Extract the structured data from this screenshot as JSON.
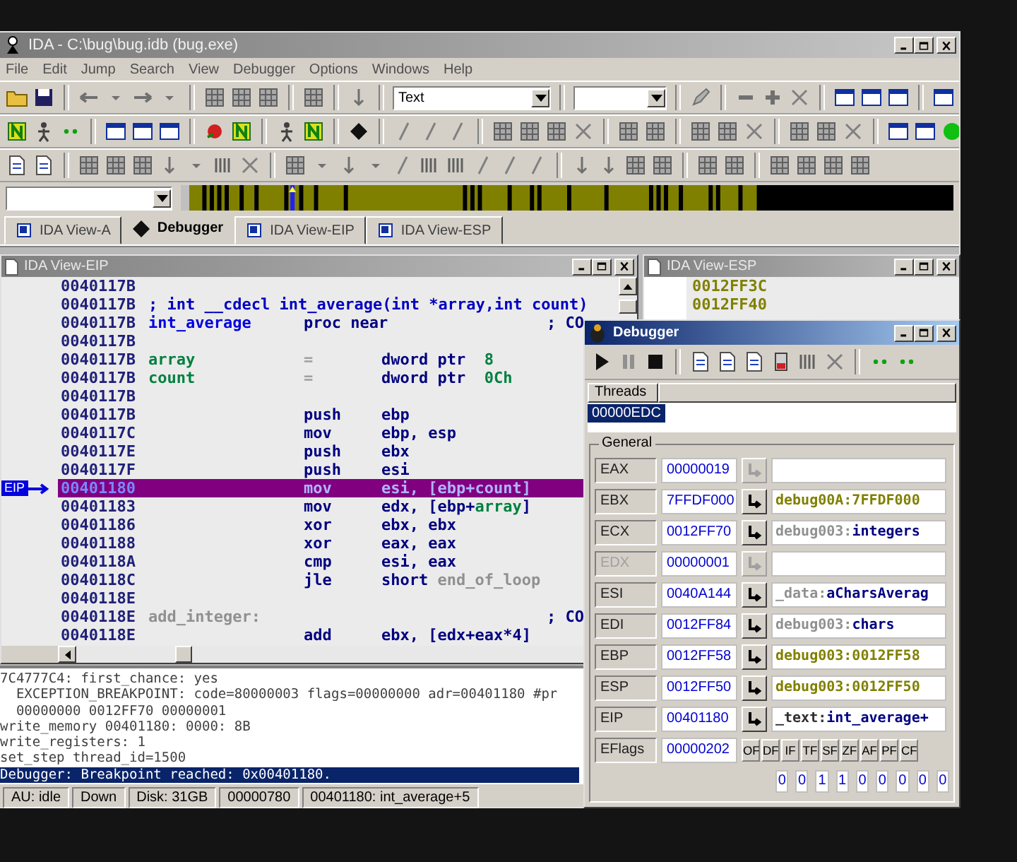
{
  "window": {
    "title": "IDA - C:\\bug\\bug.idb (bug.exe)"
  },
  "menu": [
    "File",
    "Edit",
    "Jump",
    "Search",
    "View",
    "Debugger",
    "Options",
    "Windows",
    "Help"
  ],
  "toolbar": {
    "text_combo": "Text"
  },
  "tabs": [
    {
      "label": "IDA View-A",
      "kind": "view",
      "selected": false
    },
    {
      "label": "Debugger",
      "kind": "debugger",
      "selected": true
    },
    {
      "label": "IDA View-EIP",
      "kind": "view",
      "selected": false
    },
    {
      "label": "IDA View-ESP",
      "kind": "view",
      "selected": false
    }
  ],
  "eip_view": {
    "title": "IDA View-EIP",
    "eip_marker": "EIP",
    "lines": [
      {
        "address": "0040117B",
        "kind": "blank",
        "selected": false
      },
      {
        "address": "0040117B",
        "kind": "comment",
        "text": "; int __cdecl int_average(int *array,int count)",
        "selected": false
      },
      {
        "address": "0040117B",
        "kind": "proc",
        "label": "int_average",
        "mnemonic": "proc near",
        "comment": "; CO",
        "selected": false
      },
      {
        "address": "0040117B",
        "kind": "blank",
        "selected": false
      },
      {
        "address": "0040117B",
        "kind": "stack_var",
        "label": "array",
        "mnemonic": "=",
        "operand": [
          {
            "text": "dword ptr  ",
            "kind": "plain"
          },
          {
            "text": "8",
            "kind": "number"
          }
        ],
        "selected": false
      },
      {
        "address": "0040117B",
        "kind": "stack_var",
        "label": "count",
        "mnemonic": "=",
        "operand": [
          {
            "text": "dword ptr  ",
            "kind": "plain"
          },
          {
            "text": "0Ch",
            "kind": "number"
          }
        ],
        "selected": false
      },
      {
        "address": "0040117B",
        "kind": "blank",
        "selected": false
      },
      {
        "address": "0040117B",
        "kind": "code",
        "mnemonic": "push",
        "operand": [
          {
            "text": "ebp",
            "kind": "plain"
          }
        ],
        "selected": false
      },
      {
        "address": "0040117C",
        "kind": "code",
        "mnemonic": "mov",
        "operand": [
          {
            "text": "ebp, esp",
            "kind": "plain"
          }
        ],
        "selected": false
      },
      {
        "address": "0040117E",
        "kind": "code",
        "mnemonic": "push",
        "operand": [
          {
            "text": "ebx",
            "kind": "plain"
          }
        ],
        "selected": false
      },
      {
        "address": "0040117F",
        "kind": "code",
        "mnemonic": "push",
        "operand": [
          {
            "text": "esi",
            "kind": "plain"
          }
        ],
        "selected": false
      },
      {
        "address": "00401180",
        "kind": "code",
        "mnemonic": "mov",
        "operand": [
          {
            "text": "esi, [ebp+",
            "kind": "plain"
          },
          {
            "text": "count",
            "kind": "var"
          },
          {
            "text": "]",
            "kind": "plain"
          }
        ],
        "selected": true
      },
      {
        "address": "00401183",
        "kind": "code",
        "mnemonic": "mov",
        "operand": [
          {
            "text": "edx, [ebp+",
            "kind": "plain"
          },
          {
            "text": "array",
            "kind": "var"
          },
          {
            "text": "]",
            "kind": "plain"
          }
        ],
        "selected": false
      },
      {
        "address": "00401186",
        "kind": "code",
        "mnemonic": "xor",
        "operand": [
          {
            "text": "ebx, ebx",
            "kind": "plain"
          }
        ],
        "selected": false
      },
      {
        "address": "00401188",
        "kind": "code",
        "mnemonic": "xor",
        "operand": [
          {
            "text": "eax, eax",
            "kind": "plain"
          }
        ],
        "selected": false
      },
      {
        "address": "0040118A",
        "kind": "code",
        "mnemonic": "cmp",
        "operand": [
          {
            "text": "esi, eax",
            "kind": "plain"
          }
        ],
        "selected": false
      },
      {
        "address": "0040118C",
        "kind": "code",
        "mnemonic": "jle",
        "operand": [
          {
            "text": "short ",
            "kind": "plain"
          },
          {
            "text": "end_of_loop",
            "kind": "loc"
          }
        ],
        "selected": false
      },
      {
        "address": "0040118E",
        "kind": "blank",
        "selected": false
      },
      {
        "address": "0040118E",
        "kind": "location",
        "label": "add_integer:",
        "comment": "; CO",
        "selected": false
      },
      {
        "address": "0040118E",
        "kind": "code",
        "mnemonic": "add",
        "operand": [
          {
            "text": "ebx, [edx+eax*4]",
            "kind": "plain"
          }
        ],
        "selected": false
      }
    ]
  },
  "esp_view": {
    "title": "IDA View-ESP",
    "lines": [
      "0012FF3C",
      "0012FF40"
    ]
  },
  "debugger": {
    "title": "Debugger",
    "threads_header": "Threads",
    "threads": [
      {
        "id": "00000EDC",
        "selected": true
      }
    ],
    "group": "General",
    "registers": [
      {
        "name": "EAX",
        "value": "00000019",
        "disabled": false
      },
      {
        "name": "EBX",
        "value": "7FFDF000",
        "disabled": false,
        "ref": [
          {
            "text": "debug00A:7FFDF000",
            "kind": "data"
          }
        ]
      },
      {
        "name": "ECX",
        "value": "0012FF70",
        "disabled": false,
        "ref": [
          {
            "text": "debug003:",
            "kind": "seg"
          },
          {
            "text": "integers",
            "kind": "name"
          }
        ]
      },
      {
        "name": "EDX",
        "value": "00000001",
        "disabled": true
      },
      {
        "name": "ESI",
        "value": "0040A144",
        "disabled": false,
        "ref": [
          {
            "text": "_data:",
            "kind": "seg"
          },
          {
            "text": "aCharsAverag",
            "kind": "name"
          }
        ]
      },
      {
        "name": "EDI",
        "value": "0012FF84",
        "disabled": false,
        "ref": [
          {
            "text": "debug003:",
            "kind": "seg"
          },
          {
            "text": "chars",
            "kind": "name"
          }
        ]
      },
      {
        "name": "EBP",
        "value": "0012FF58",
        "disabled": false,
        "ref": [
          {
            "text": "debug003:0012FF58",
            "kind": "data"
          }
        ]
      },
      {
        "name": "ESP",
        "value": "0012FF50",
        "disabled": false,
        "ref": [
          {
            "text": "debug003:0012FF50",
            "kind": "data"
          }
        ]
      },
      {
        "name": "EIP",
        "value": "00401180",
        "disabled": false,
        "ref": [
          {
            "text": "_text:",
            "kind": "code_seg"
          },
          {
            "text": "int_average+",
            "kind": "name"
          }
        ]
      }
    ],
    "eflags": {
      "name": "EFlags",
      "value": "00000202"
    },
    "flags": [
      {
        "name": "OF",
        "value": "0"
      },
      {
        "name": "DF",
        "value": "0"
      },
      {
        "name": "IF",
        "value": "1"
      },
      {
        "name": "TF",
        "value": "1"
      },
      {
        "name": "SF",
        "value": "0"
      },
      {
        "name": "ZF",
        "value": "0"
      },
      {
        "name": "AF",
        "value": "0"
      },
      {
        "name": "PF",
        "value": "0"
      },
      {
        "name": "CF",
        "value": "0"
      }
    ]
  },
  "output": {
    "lines": [
      {
        "text": "7C4777C4: first_chance: yes",
        "selected": false
      },
      {
        "text": "  EXCEPTION_BREAKPOINT: code=80000003 flags=00000000 adr=00401180 #pr",
        "selected": false
      },
      {
        "text": "  00000000 0012FF70 00000001",
        "selected": false
      },
      {
        "text": "write_memory 00401180: 0000: 8B",
        "selected": false
      },
      {
        "text": "write_registers: 1",
        "selected": false
      },
      {
        "text": "set_step thread_id=1500",
        "selected": false
      },
      {
        "text": "Debugger: Breakpoint reached: 0x00401180.",
        "selected": true
      }
    ]
  },
  "status_bar": [
    "AU: idle",
    "Down",
    "Disk: 31GB",
    "00000780",
    "00401180: int_average+5"
  ]
}
